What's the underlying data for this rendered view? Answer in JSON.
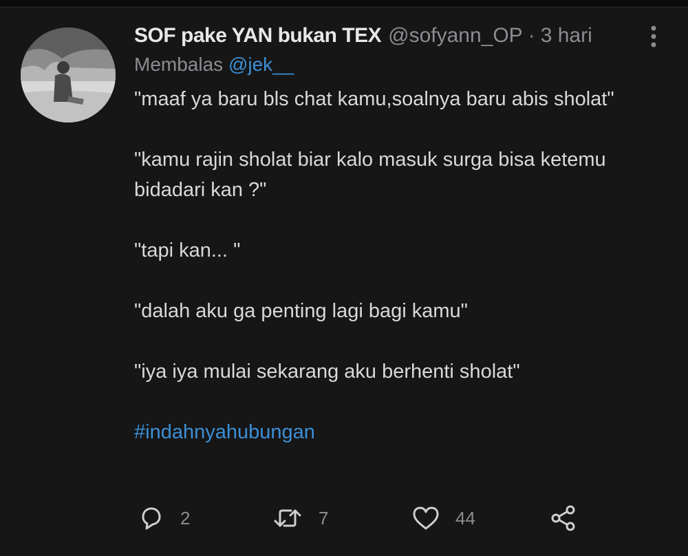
{
  "tweet": {
    "display_name": "SOF pake YAN bukan TEX",
    "handle": "@sofyann_OP",
    "separator": "·",
    "time": "3 hari",
    "replying_prefix": "Membalas",
    "replying_to": "@jek__",
    "paragraphs": [
      "\"maaf ya baru bls chat kamu,soalnya baru abis sholat\"",
      "\"kamu rajin sholat biar kalo masuk surga bisa ketemu bidadari kan ?\"",
      "\"tapi kan... \"",
      "\"dalah aku ga penting lagi bagi kamu\"",
      "\"iya iya mulai sekarang aku berhenti sholat\""
    ],
    "hashtag": "#indahnyahubungan"
  },
  "actions": {
    "reply_count": "2",
    "retweet_count": "7",
    "like_count": "44"
  },
  "icons": {
    "more": "more-vertical-icon",
    "reply": "reply-icon",
    "retweet": "retweet-icon",
    "like": "heart-icon",
    "share": "share-icon"
  },
  "colors": {
    "background": "#161616",
    "text": "#d9d9d9",
    "muted": "#8a8d91",
    "accent": "#3c8fd6"
  }
}
